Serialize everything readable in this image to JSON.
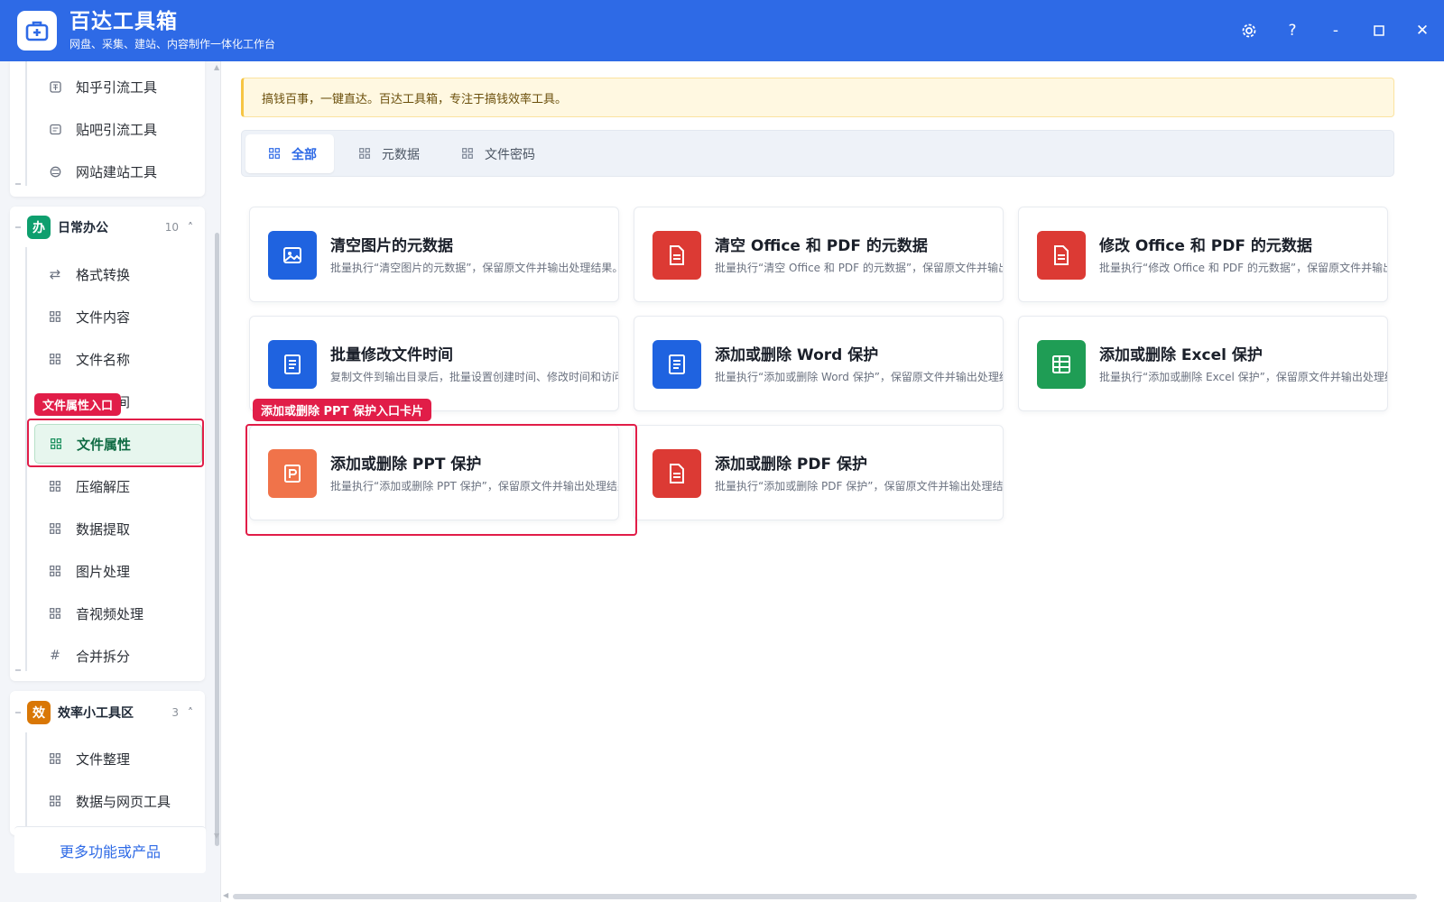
{
  "app": {
    "title": "百达工具箱",
    "subtitle": "网盘、采集、建站、内容制作一体化工作台"
  },
  "window_controls": [
    {
      "name": "settings",
      "glyph": "⚙"
    },
    {
      "name": "help",
      "glyph": "?"
    },
    {
      "name": "minimize",
      "glyph": "-"
    },
    {
      "name": "maximize",
      "glyph": "□"
    },
    {
      "name": "close",
      "glyph": "✕"
    }
  ],
  "sidebar": {
    "top_group_items": [
      {
        "label": "知乎引流工具",
        "icon": "zhihu-icon"
      },
      {
        "label": "贴吧引流工具",
        "icon": "tieba-icon"
      },
      {
        "label": "网站建站工具",
        "icon": "website-icon"
      }
    ],
    "office_group": {
      "badge": "办",
      "badge_color": "#0e9f6e",
      "title": "日常办公",
      "count": "10",
      "items": [
        {
          "label": "格式转换",
          "icon": "swap-icon"
        },
        {
          "label": "文件内容",
          "icon": "grid-icon"
        },
        {
          "label": "文件名称",
          "icon": "grid-icon"
        },
        {
          "label": "文件时间",
          "icon": "grid-icon"
        },
        {
          "label": "文件属性",
          "icon": "grid-icon",
          "active": true
        },
        {
          "label": "压缩解压",
          "icon": "grid-icon"
        },
        {
          "label": "数据提取",
          "icon": "grid-icon"
        },
        {
          "label": "图片处理",
          "icon": "grid-icon"
        },
        {
          "label": "音视频处理",
          "icon": "grid-icon"
        },
        {
          "label": "合并拆分",
          "icon": "hash-icon"
        }
      ]
    },
    "efficiency_group": {
      "badge": "效",
      "badge_color": "#d97706",
      "title": "效率小工具区",
      "count": "3",
      "items": [
        {
          "label": "文件整理",
          "icon": "grid-icon"
        },
        {
          "label": "数据与网页工具",
          "icon": "grid-icon"
        }
      ]
    },
    "more_button": "更多功能或产品"
  },
  "annotations": {
    "sidebar_label": "文件属性入口",
    "card_label": "添加或删除 PPT 保护入口卡片",
    "color": "#e11d48"
  },
  "notice": "搞钱百事，一键直达。百达工具箱，专注于搞钱效率工具。",
  "tabs": [
    {
      "label": "全部",
      "active": true
    },
    {
      "label": "元数据",
      "active": false
    },
    {
      "label": "文件密码",
      "active": false
    }
  ],
  "cards": [
    {
      "title": "清空图片的元数据",
      "desc": "批量执行“清空图片的元数据”，保留原文件并输出处理结果。",
      "icon": "image-icon",
      "color": "#1f63e0"
    },
    {
      "title": "清空 Office 和 PDF 的元数据",
      "desc": "批量执行“清空 Office 和 PDF 的元数据”，保留原文件并输出处理结果。",
      "icon": "document-icon",
      "color": "#dc3a34"
    },
    {
      "title": "修改 Office 和 PDF 的元数据",
      "desc": "批量执行“修改 Office 和 PDF 的元数据”，保留原文件并输出处理结果。",
      "icon": "document-icon",
      "color": "#dc3a34"
    },
    {
      "title": "批量修改文件时间",
      "desc": "复制文件到输出目录后，批量设置创建时间、修改时间和访问时间。",
      "icon": "list-document-icon",
      "color": "#1f63e0"
    },
    {
      "title": "添加或删除 Word 保护",
      "desc": "批量执行“添加或删除 Word 保护”，保留原文件并输出处理结果。",
      "icon": "word-icon",
      "color": "#1f63e0"
    },
    {
      "title": "添加或删除 Excel 保护",
      "desc": "批量执行“添加或删除 Excel 保护”，保留原文件并输出处理结果。",
      "icon": "spreadsheet-icon",
      "color": "#1f9d55"
    },
    {
      "title": "添加或删除 PPT 保护",
      "desc": "批量执行“添加或删除 PPT 保护”，保留原文件并输出处理结果。",
      "icon": "presentation-icon",
      "color": "#f0734a"
    },
    {
      "title": "添加或删除 PDF 保护",
      "desc": "批量执行“添加或删除 PDF 保护”，保留原文件并输出处理结果。",
      "icon": "pdf-icon",
      "color": "#dc3a34"
    }
  ]
}
